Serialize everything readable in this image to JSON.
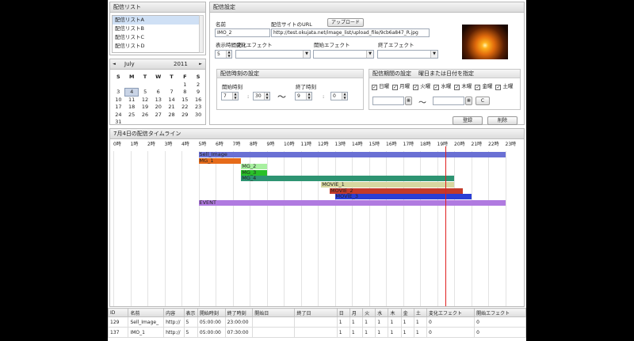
{
  "list_panel": {
    "title": "配信リスト",
    "items": [
      "配信リストA",
      "配信リストB",
      "配信リストC",
      "配信リストD"
    ]
  },
  "calendar": {
    "month": "July",
    "year": "2011",
    "prev": "◄",
    "next": "►",
    "weekdays": [
      "S",
      "M",
      "T",
      "W",
      "T",
      "F",
      "S"
    ],
    "weeks": [
      [
        "",
        "",
        "",
        "",
        "",
        "1",
        "2"
      ],
      [
        "3",
        "4",
        "5",
        "6",
        "7",
        "8",
        "9"
      ],
      [
        "10",
        "11",
        "12",
        "13",
        "14",
        "15",
        "16"
      ],
      [
        "17",
        "18",
        "19",
        "20",
        "21",
        "22",
        "23"
      ],
      [
        "24",
        "25",
        "26",
        "27",
        "28",
        "29",
        "30"
      ],
      [
        "31",
        "",
        "",
        "",
        "",
        "",
        ""
      ]
    ],
    "selected": "4"
  },
  "settings": {
    "title": "配信設定",
    "name_label": "名前",
    "name_value": "IMO_2",
    "url_label": "配信サイトのURL",
    "upload_button": "アップロード",
    "url_value": "http://test.okujata.net/image_list/upload_file/9cb6a847_R.jpg",
    "duration_label": "表示時間(秒)",
    "duration_value": "5",
    "effect1_label": "変化エフェクト",
    "effect2_label": "開始エフェクト",
    "effect3_label": "終了エフェクト"
  },
  "time_box": {
    "title": "配信時刻の設定",
    "start_label": "開始時刻",
    "start_h": "7",
    "start_m": "30",
    "end_label": "終了時刻",
    "end_h": "9",
    "end_m": "0",
    "colon": ":",
    "tilde": "〜"
  },
  "period_box": {
    "title": "配信期間の設定",
    "subtitle": "曜日または日付を指定",
    "days": [
      "日曜",
      "月曜",
      "火曜",
      "水曜",
      "木曜",
      "金曜",
      "土曜"
    ],
    "tilde": "〜",
    "clear_button": "C"
  },
  "actions": {
    "register": "登録",
    "delete": "削除"
  },
  "timeline": {
    "title": "7月4日の配信タイムライン",
    "hours": [
      "0時",
      "1時",
      "2時",
      "3時",
      "4時",
      "5時",
      "6時",
      "7時",
      "8時",
      "9時",
      "10時",
      "11時",
      "12時",
      "13時",
      "14時",
      "15時",
      "16時",
      "17時",
      "18時",
      "19時",
      "20時",
      "21時",
      "22時",
      "23時"
    ],
    "now_hour": 19.5,
    "bars": [
      {
        "label": "Sell_Image",
        "start": 5.0,
        "end": 23.0,
        "row": 0,
        "color": "#6a70d4"
      },
      {
        "label": "MG_1",
        "start": 5.0,
        "end": 7.5,
        "row": 1,
        "color": "#e66b1a"
      },
      {
        "label": "MG_2",
        "start": 7.5,
        "end": 9.0,
        "row": 2,
        "color": "#a8f0a0"
      },
      {
        "label": "MG_3",
        "start": 7.5,
        "end": 9.0,
        "row": 3,
        "color": "#28c028"
      },
      {
        "label": "MG_4",
        "start": 7.5,
        "end": 20.0,
        "row": 4,
        "color": "#2e9472"
      },
      {
        "label": "MOVIE_1",
        "start": 12.2,
        "end": 20.0,
        "row": 5,
        "color": "#d7d7a0"
      },
      {
        "label": "MOVIE_2",
        "start": 12.7,
        "end": 20.5,
        "row": 6,
        "color": "#c33a2a"
      },
      {
        "label": "MOVIE_3",
        "start": 13.0,
        "end": 21.0,
        "row": 7,
        "color": "#2a3ed6"
      },
      {
        "label": "EVENT",
        "start": 5.0,
        "end": 23.0,
        "row": 8,
        "color": "#b07ae0"
      }
    ]
  },
  "table": {
    "headers": [
      "ID",
      "名前",
      "内容",
      "表示",
      "開始時刻",
      "終了時刻",
      "開始日",
      "終了日",
      "日",
      "月",
      "火",
      "水",
      "木",
      "金",
      "土",
      "変化エフェクト",
      "開始エフェクト"
    ],
    "rows": [
      [
        "129",
        "Sell_Image_",
        "http://",
        "5",
        "05:00:00",
        "23:00:00",
        "",
        "",
        "1",
        "1",
        "1",
        "1",
        "1",
        "1",
        "1",
        "0",
        "0"
      ],
      [
        "137",
        "IMO_1",
        "http://",
        "5",
        "05:00:00",
        "07:30:00",
        "",
        "",
        "1",
        "1",
        "1",
        "1",
        "1",
        "1",
        "1",
        "0",
        "0"
      ]
    ]
  },
  "colors": {
    "accent": "#cfe0f5",
    "now_line": "#e02020"
  }
}
